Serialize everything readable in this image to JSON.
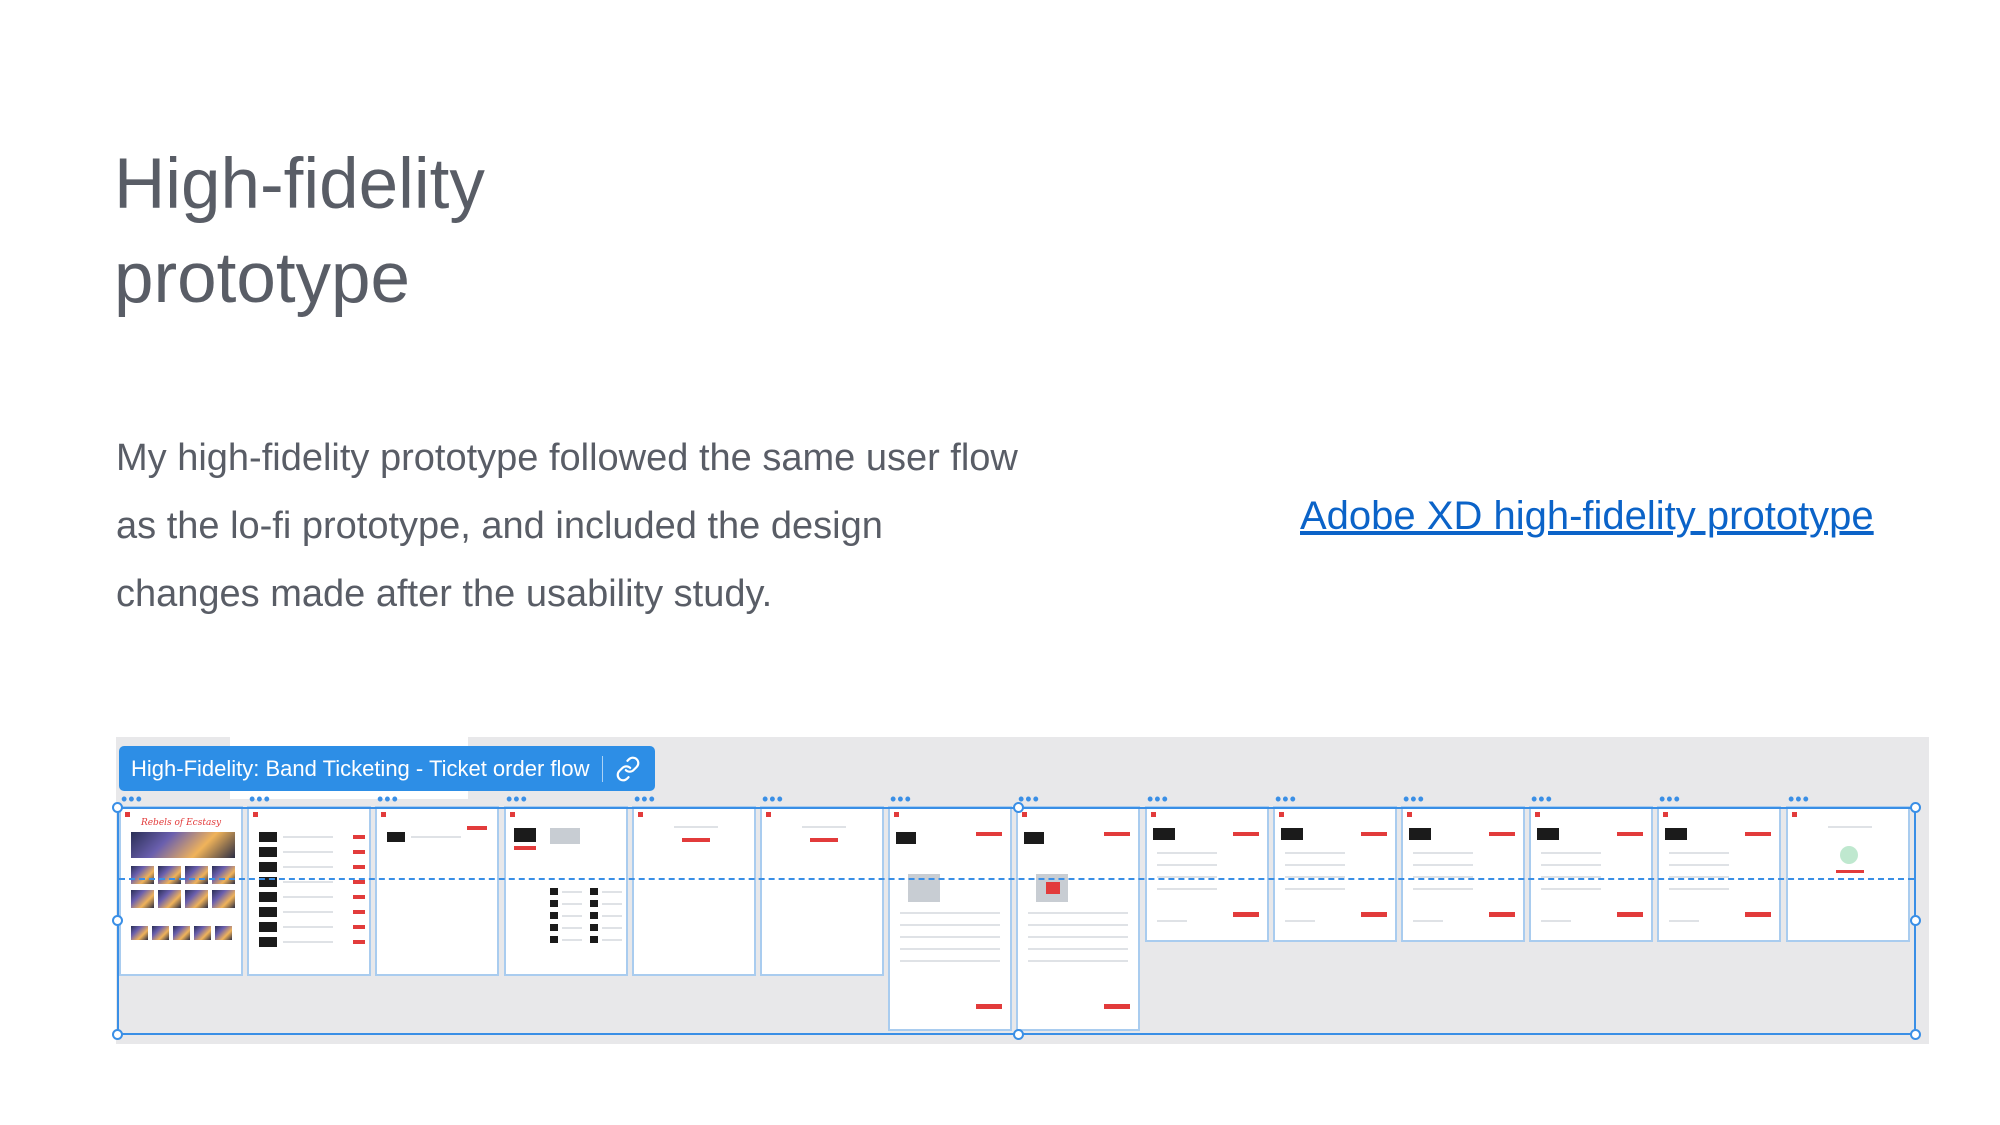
{
  "heading": {
    "line1": "High-fidelity",
    "line2": "prototype"
  },
  "description": "My high-fidelity prototype followed the same user flow as the lo-fi prototype, and included the design changes made after the usability study.",
  "link": {
    "label": "Adobe XD high-fidelity prototype"
  },
  "flow": {
    "label": "High-Fidelity: Band Ticketing - Ticket order flow",
    "link_icon": "link-icon",
    "frame_count": 14,
    "home_title": "Rebels of Ecstasy"
  },
  "colors": {
    "heading": "#595d66",
    "link": "#0b63c8",
    "badge": "#2d8ee6",
    "selection": "#3a8fe6",
    "canvas": "#e8e8ea",
    "accent_red": "#e23b3b"
  }
}
